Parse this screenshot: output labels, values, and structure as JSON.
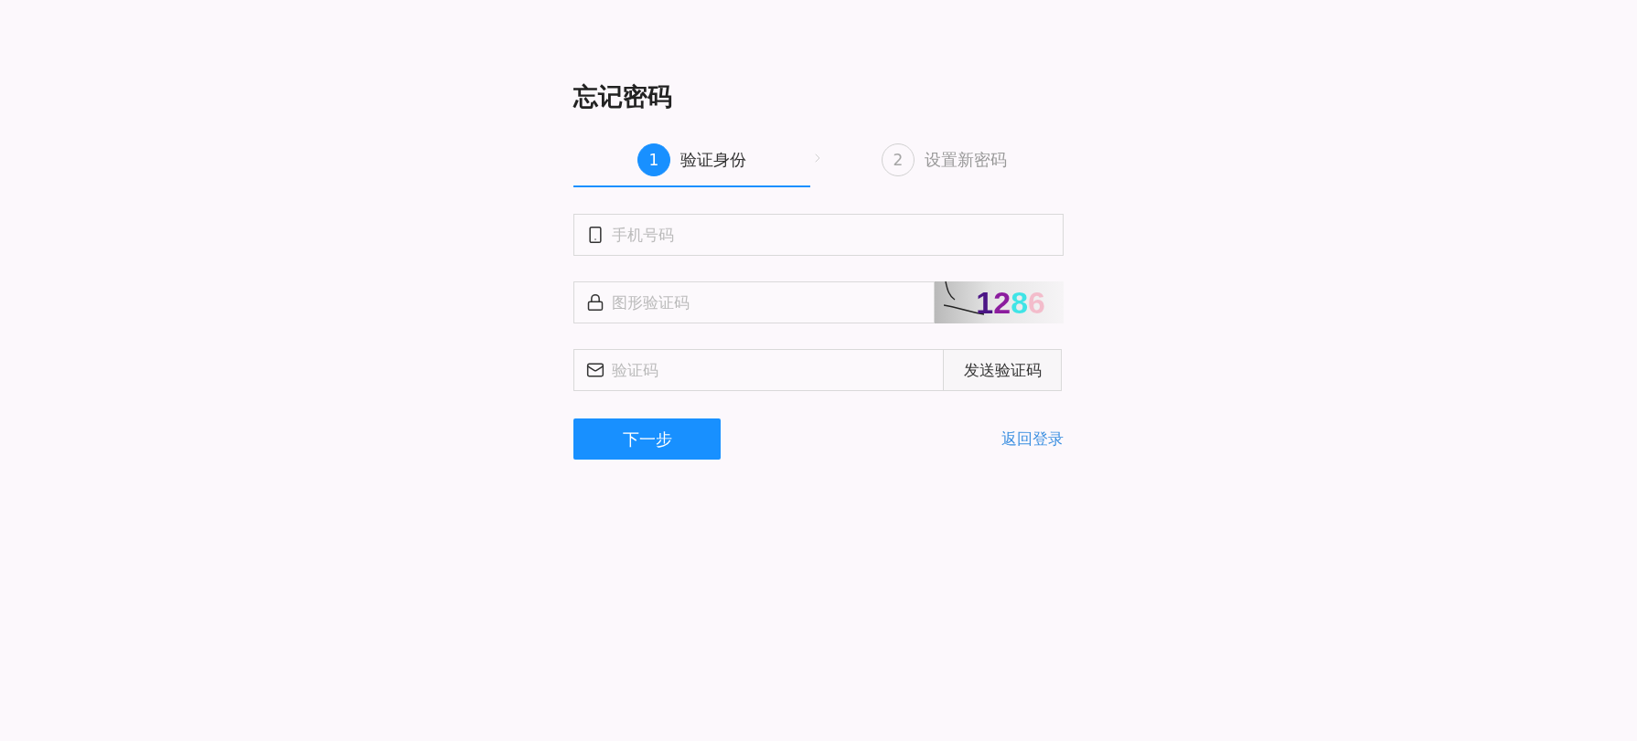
{
  "title": "忘记密码",
  "steps": [
    {
      "number": "1",
      "label": "验证身份",
      "selected": true
    },
    {
      "number": "2",
      "label": "设置新密码",
      "selected": false
    }
  ],
  "fields": [
    {
      "kind": "phone",
      "placeholder": "手机号码"
    },
    {
      "kind": "captcha",
      "placeholder": "图形验证码",
      "captcha_text": "1286"
    },
    {
      "kind": "sms",
      "placeholder": "验证码",
      "button": "发送验证码"
    }
  ],
  "actions": {
    "next_button": "下一步",
    "back_link": "返回登录"
  }
}
